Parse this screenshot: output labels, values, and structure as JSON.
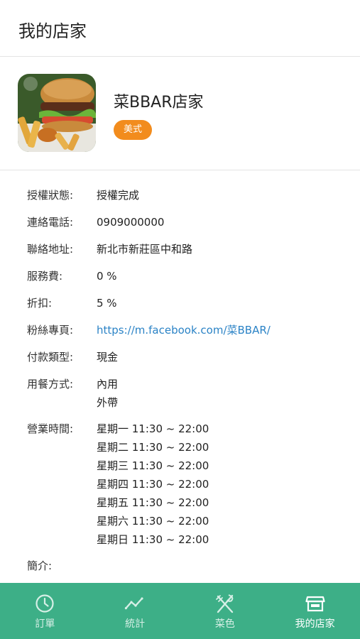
{
  "header": {
    "title": "我的店家"
  },
  "store": {
    "name": "菜BBAR店家",
    "tag": "美式"
  },
  "info": [
    {
      "label": "授權狀態:",
      "values": [
        "授權完成"
      ],
      "link": false
    },
    {
      "label": "連絡電話:",
      "values": [
        "0909000000"
      ],
      "link": false
    },
    {
      "label": "聯絡地址:",
      "values": [
        "新北市新莊區中和路"
      ],
      "link": false
    },
    {
      "label": "服務費:",
      "values": [
        "0 %"
      ],
      "link": false
    },
    {
      "label": "折扣:",
      "values": [
        "5 %"
      ],
      "link": false
    },
    {
      "label": "粉絲專頁:",
      "values": [
        "https://m.facebook.com/菜BBAR/"
      ],
      "link": true
    },
    {
      "label": "付款類型:",
      "values": [
        "現金"
      ],
      "link": false
    },
    {
      "label": "用餐方式:",
      "values": [
        "內用",
        "外帶"
      ],
      "link": false
    },
    {
      "label": "營業時間:",
      "values": [
        "星期一 11:30 ~ 22:00",
        "星期二 11:30 ~ 22:00",
        "星期三 11:30 ~ 22:00",
        "星期四 11:30 ~ 22:00",
        "星期五 11:30 ~ 22:00",
        "星期六 11:30 ~ 22:00",
        "星期日 11:30 ~ 22:00"
      ],
      "link": false
    },
    {
      "label": "簡介:",
      "values": [],
      "link": false
    }
  ],
  "tabbar": {
    "tabs": [
      {
        "label": "訂單",
        "icon": "clock-icon",
        "active": false
      },
      {
        "label": "統計",
        "icon": "chart-line-icon",
        "active": false
      },
      {
        "label": "菜色",
        "icon": "utensils-icon",
        "active": false
      },
      {
        "label": "我的店家",
        "icon": "store-icon",
        "active": true
      }
    ]
  },
  "colors": {
    "accent": "#3daf87",
    "tag": "#f28c1d",
    "link": "#2b83c6"
  }
}
